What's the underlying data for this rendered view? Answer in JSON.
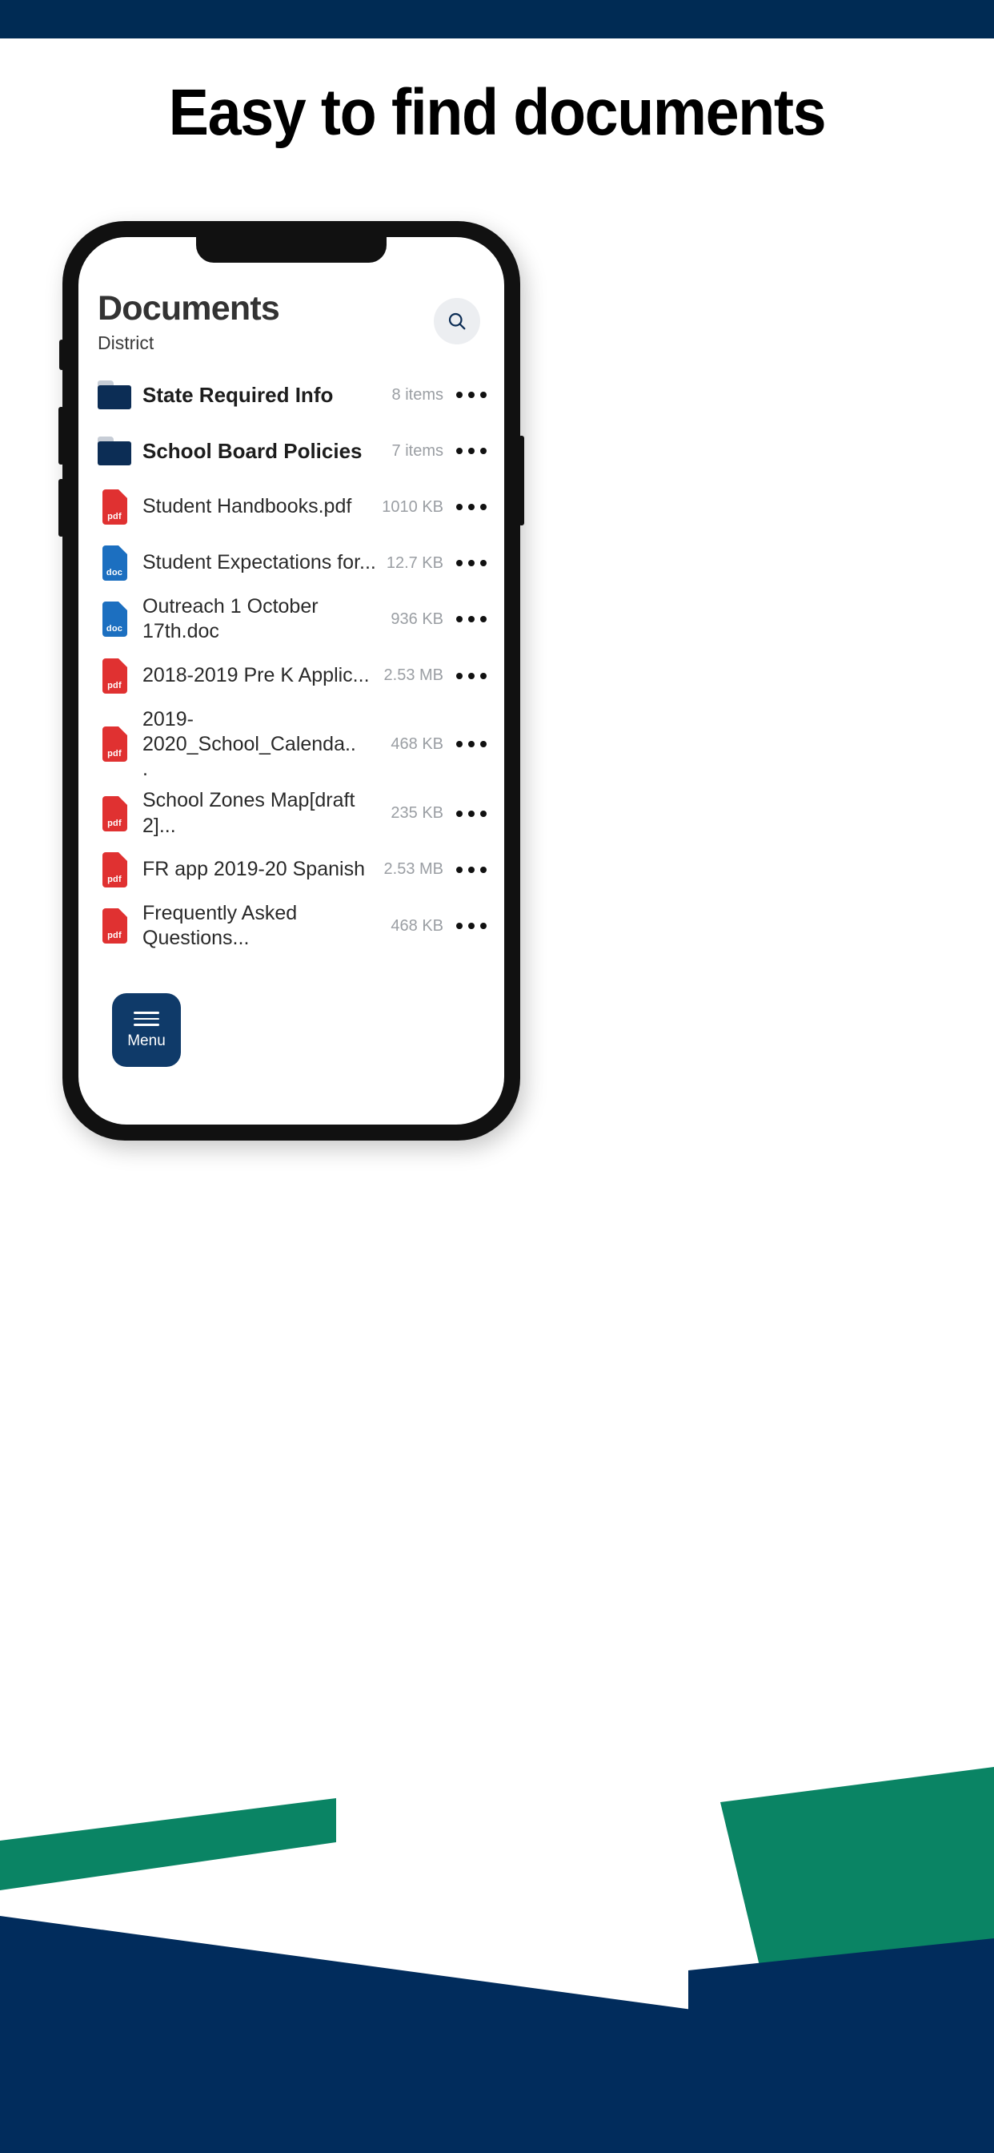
{
  "theme": {
    "navy": "#002b54",
    "deep_navy": "#0c2d55",
    "teal": "#0a8464",
    "pdf_red": "#e03131",
    "doc_blue": "#1c6fc0",
    "meta_gray": "#9a9ea3",
    "search_bg": "#eceef1"
  },
  "headline": "Easy to find documents",
  "app": {
    "title": "Documents",
    "subtitle": "District",
    "search_icon": "search-icon",
    "menu": {
      "label": "Menu",
      "icon": "hamburger-icon"
    },
    "more_icon": "ellipsis-icon",
    "rows": [
      {
        "type": "folder",
        "icon": "folder-icon",
        "name": "State Required Info",
        "meta": "8 items"
      },
      {
        "type": "folder",
        "icon": "folder-icon",
        "name": "School Board Policies",
        "meta": "7 items"
      },
      {
        "type": "file",
        "icon": "pdf-file-icon",
        "ext": "pdf",
        "name": "Student Handbooks.pdf",
        "meta": "1010 KB"
      },
      {
        "type": "file",
        "icon": "doc-file-icon",
        "ext": "doc",
        "name": "Student Expectations for...",
        "meta": "12.7 KB"
      },
      {
        "type": "file",
        "icon": "doc-file-icon",
        "ext": "doc",
        "name": "Outreach 1 October 17th.doc",
        "meta": "936 KB"
      },
      {
        "type": "file",
        "icon": "pdf-file-icon",
        "ext": "pdf",
        "name": "2018-2019 Pre K Applic...",
        "meta": "2.53 MB"
      },
      {
        "type": "file",
        "icon": "pdf-file-icon",
        "ext": "pdf",
        "name": "2019-2020_School_Calenda..\n.",
        "meta": "468 KB"
      },
      {
        "type": "file",
        "icon": "pdf-file-icon",
        "ext": "pdf",
        "name": "School Zones Map[draft 2]...",
        "meta": "235 KB"
      },
      {
        "type": "file",
        "icon": "pdf-file-icon",
        "ext": "pdf",
        "name": "FR app 2019-20 Spanish",
        "meta": "2.53 MB"
      },
      {
        "type": "file",
        "icon": "pdf-file-icon",
        "ext": "pdf",
        "name": "Frequently Asked Questions...",
        "meta": "468 KB"
      }
    ]
  }
}
